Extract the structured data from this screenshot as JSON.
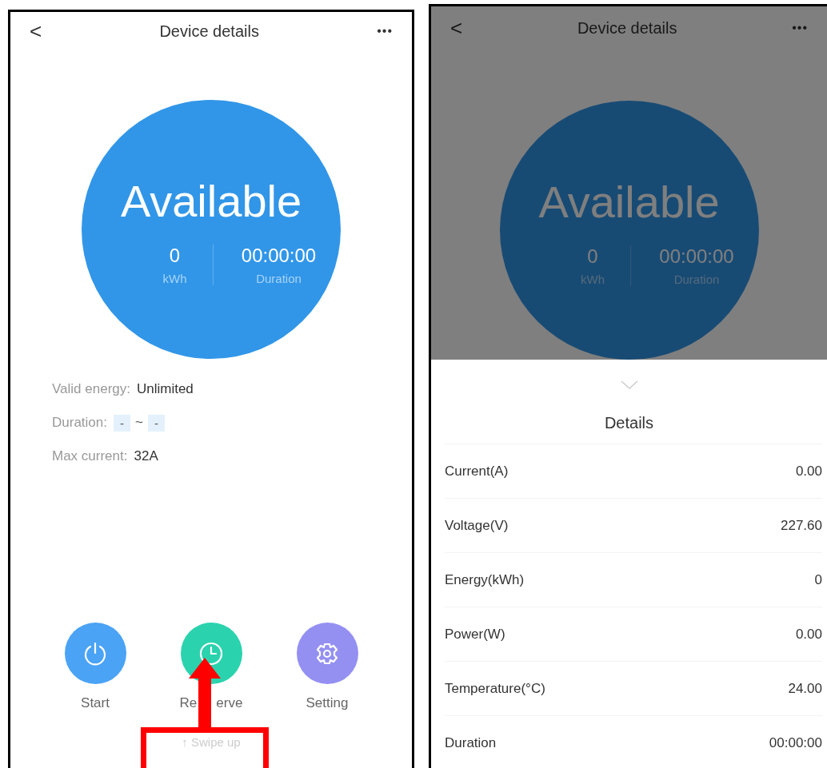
{
  "main_screen": {
    "header": {
      "back": "<",
      "title": "Device details",
      "more": "•••"
    },
    "status": {
      "label": "Available",
      "energy": "0",
      "energy_unit": "kWh",
      "duration": "00:00:00",
      "duration_label": "Duration"
    },
    "info": [
      {
        "kind": "text",
        "label": "Valid energy:",
        "value": "Unlimited"
      },
      {
        "kind": "range",
        "label": "Duration:",
        "from": "-",
        "sep": "~",
        "to": "-"
      },
      {
        "kind": "text",
        "label": "Max current:",
        "value": "32A"
      }
    ],
    "actions": [
      {
        "kind": "power",
        "label": "Start",
        "color": "#4aa3f5"
      },
      {
        "kind": "clock",
        "label_parts": [
          "Re",
          "erve"
        ],
        "color": "#2ad3ae"
      },
      {
        "kind": "gear",
        "label": "Setting",
        "color": "#9490f2"
      }
    ],
    "hint": "↑ Swipe up"
  },
  "details_screen": {
    "dimmed": true,
    "header": {
      "back": "<",
      "title": "Device details",
      "more": "•••"
    },
    "status": {
      "label": "Available",
      "energy": "0",
      "energy_unit": "kWh",
      "duration": "00:00:00",
      "duration_label": "Duration"
    },
    "sheet_title": "Details",
    "rows": [
      {
        "label": "Current(A)",
        "value": "0.00"
      },
      {
        "label": "Voltage(V)",
        "value": "227.60"
      },
      {
        "label": "Energy(kWh)",
        "value": "0"
      },
      {
        "label": "Power(W)",
        "value": "0.00"
      },
      {
        "label": "Temperature(°C)",
        "value": "24.00"
      },
      {
        "label": "Duration",
        "value": "00:00:00"
      }
    ]
  }
}
